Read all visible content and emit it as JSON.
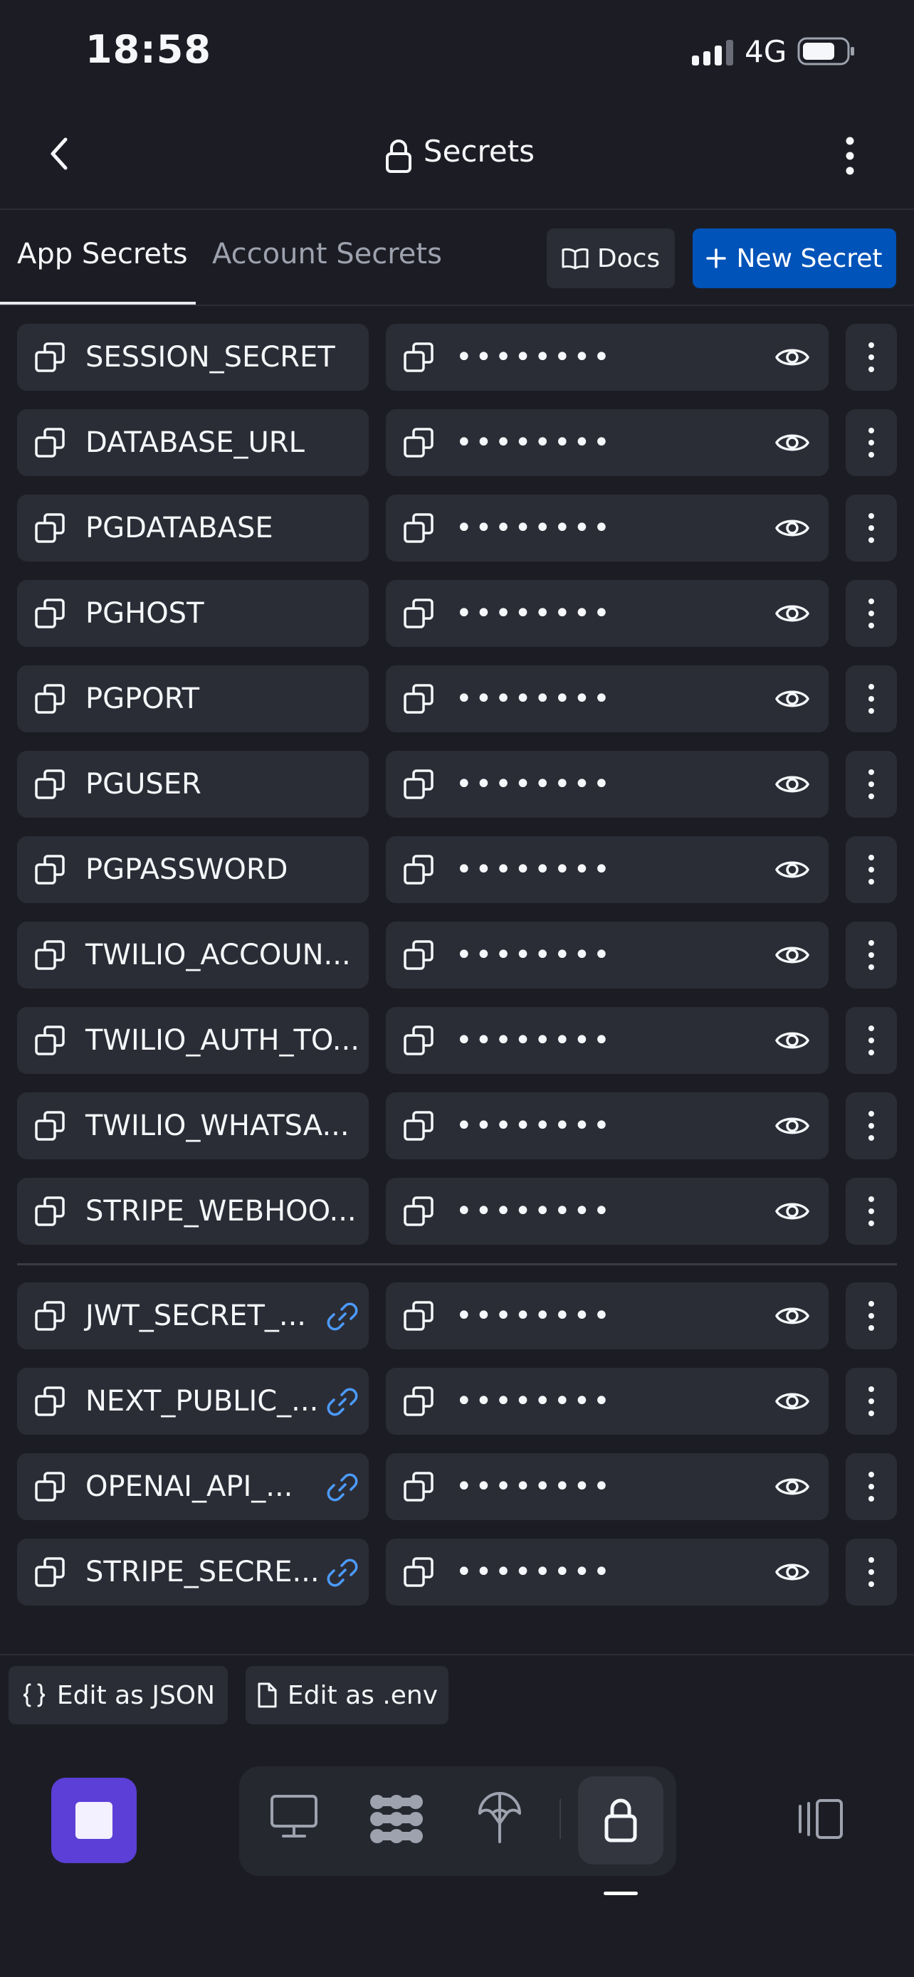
{
  "status": {
    "time": "18:58",
    "network": "4G"
  },
  "header": {
    "title": "Secrets"
  },
  "tabs": {
    "active": "App Secrets",
    "inactive": "Account Secrets"
  },
  "buttons": {
    "docs": "Docs",
    "new_secret": "New Secret",
    "edit_json": "Edit as JSON",
    "edit_env": "Edit as .env"
  },
  "secrets": [
    {
      "key": "SESSION_SECRET",
      "value": "••••••••"
    },
    {
      "key": "DATABASE_URL",
      "value": "••••••••"
    },
    {
      "key": "PGDATABASE",
      "value": "••••••••"
    },
    {
      "key": "PGHOST",
      "value": "••••••••"
    },
    {
      "key": "PGPORT",
      "value": "••••••••"
    },
    {
      "key": "PGUSER",
      "value": "••••••••"
    },
    {
      "key": "PGPASSWORD",
      "value": "••••••••"
    },
    {
      "key": "TWILIO_ACCOUN...",
      "value": "••••••••"
    },
    {
      "key": "TWILIO_AUTH_TO...",
      "value": "••••••••"
    },
    {
      "key": "TWILIO_WHATSA...",
      "value": "••••••••"
    },
    {
      "key": "STRIPE_WEBHOO...",
      "value": "••••••••"
    }
  ],
  "linked_secrets": [
    {
      "key": "JWT_SECRET_...",
      "value": "••••••••"
    },
    {
      "key": "NEXT_PUBLIC_...",
      "value": "••••••••"
    },
    {
      "key": "OPENAI_API_...",
      "value": "••••••••"
    },
    {
      "key": "STRIPE_SECRE...",
      "value": "••••••••"
    }
  ],
  "icons": {
    "back": "chevron-left-icon",
    "lock": "lock-icon",
    "menu": "vertical-dots-icon",
    "copy": "copy-icon",
    "eye": "eye-icon",
    "link": "link-icon",
    "docs": "book-icon",
    "plus": "plus-icon",
    "json": "braces-icon",
    "file": "file-icon",
    "nav": [
      "stop-icon",
      "desktop-icon",
      "workflow-icon",
      "deploy-icon",
      "lock-icon",
      "panel-icon"
    ]
  },
  "colors": {
    "background": "#1c1d24",
    "surface": "#2b2d36",
    "primary": "#0053b8",
    "stop": "#5b3fd6",
    "link": "#4c9bff"
  }
}
